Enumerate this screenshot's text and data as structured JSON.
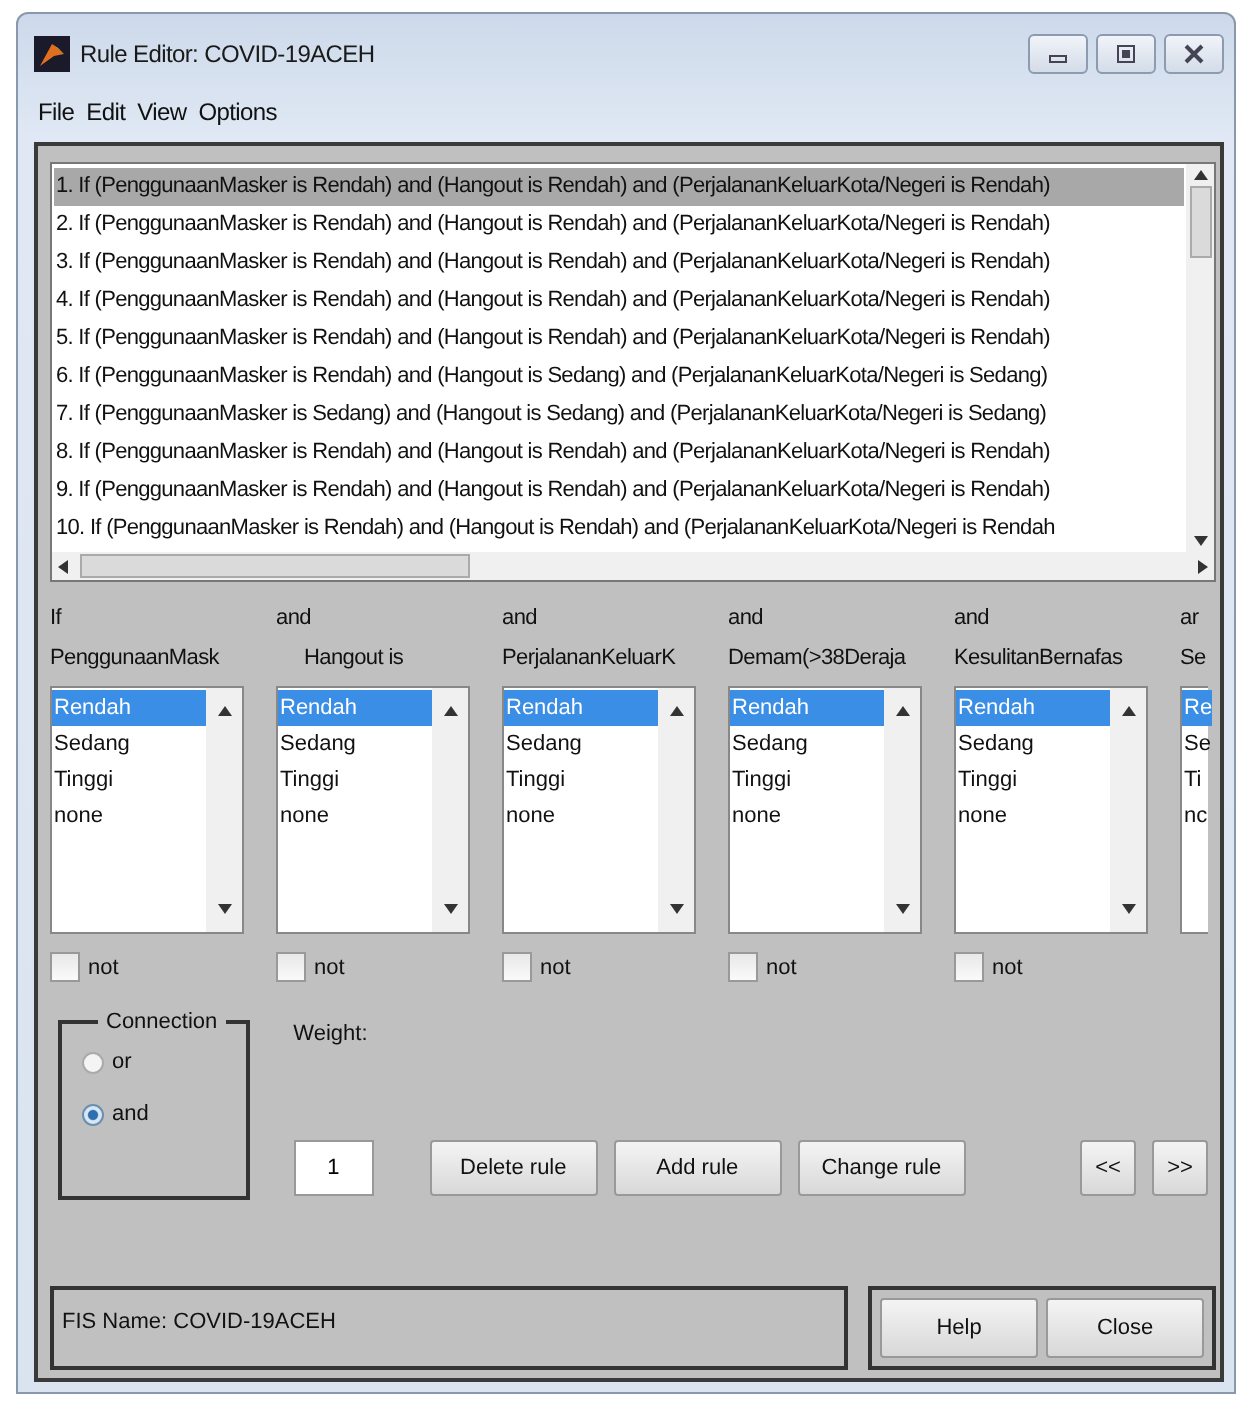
{
  "window": {
    "title": "Rule Editor: COVID-19ACEH"
  },
  "menu": [
    "File",
    "Edit",
    "View",
    "Options"
  ],
  "rules": [
    {
      "text": "1. If (PenggunaanMasker is Rendah) and (Hangout is Rendah) and (PerjalananKeluarKota/Negeri is Rendah)",
      "selected": true
    },
    {
      "text": "2. If (PenggunaanMasker is Rendah) and (Hangout is Rendah) and (PerjalananKeluarKota/Negeri is Rendah)",
      "selected": false
    },
    {
      "text": "3. If (PenggunaanMasker is Rendah) and (Hangout is Rendah) and (PerjalananKeluarKota/Negeri is Rendah)",
      "selected": false
    },
    {
      "text": "4. If (PenggunaanMasker is Rendah) and (Hangout is Rendah) and (PerjalananKeluarKota/Negeri is Rendah)",
      "selected": false
    },
    {
      "text": "5. If (PenggunaanMasker is Rendah) and (Hangout is Rendah) and (PerjalananKeluarKota/Negeri is Rendah)",
      "selected": false
    },
    {
      "text": "6. If (PenggunaanMasker is Rendah) and (Hangout is Sedang) and (PerjalananKeluarKota/Negeri is Sedang)",
      "selected": false
    },
    {
      "text": "7. If (PenggunaanMasker is Sedang) and (Hangout is Sedang) and (PerjalananKeluarKota/Negeri is Sedang)",
      "selected": false
    },
    {
      "text": "8. If (PenggunaanMasker is Rendah) and (Hangout is Rendah) and (PerjalananKeluarKota/Negeri is Rendah)",
      "selected": false
    },
    {
      "text": "9. If (PenggunaanMasker is Rendah) and (Hangout is Rendah) and (PerjalananKeluarKota/Negeri is Rendah)",
      "selected": false
    },
    {
      "text": "10. If (PenggunaanMasker is Rendah) and (Hangout is Rendah) and (PerjalananKeluarKota/Negeri is Rendah",
      "selected": false
    }
  ],
  "columns": [
    {
      "connector": "If",
      "label": "PenggunaanMask",
      "items": [
        {
          "text": "Rendah",
          "selected": true
        },
        {
          "text": "Sedang",
          "selected": false
        },
        {
          "text": "Tinggi",
          "selected": false
        },
        {
          "text": "none",
          "selected": false
        }
      ],
      "not_label": "not",
      "not_checked": false
    },
    {
      "connector": "and",
      "label": "Hangout is",
      "items": [
        {
          "text": "Rendah",
          "selected": true
        },
        {
          "text": "Sedang",
          "selected": false
        },
        {
          "text": "Tinggi",
          "selected": false
        },
        {
          "text": "none",
          "selected": false
        }
      ],
      "not_label": "not",
      "not_checked": false
    },
    {
      "connector": "and",
      "label": "PerjalananKeluarK",
      "items": [
        {
          "text": "Rendah",
          "selected": true
        },
        {
          "text": "Sedang",
          "selected": false
        },
        {
          "text": "Tinggi",
          "selected": false
        },
        {
          "text": "none",
          "selected": false
        }
      ],
      "not_label": "not",
      "not_checked": false
    },
    {
      "connector": "and",
      "label": "Demam(>38Deraja",
      "items": [
        {
          "text": "Rendah",
          "selected": true
        },
        {
          "text": "Sedang",
          "selected": false
        },
        {
          "text": "Tinggi",
          "selected": false
        },
        {
          "text": "none",
          "selected": false
        }
      ],
      "not_label": "not",
      "not_checked": false
    },
    {
      "connector": "and",
      "label": "KesulitanBernafas",
      "items": [
        {
          "text": "Rendah",
          "selected": true
        },
        {
          "text": "Sedang",
          "selected": false
        },
        {
          "text": "Tinggi",
          "selected": false
        },
        {
          "text": "none",
          "selected": false
        }
      ],
      "not_label": "not",
      "not_checked": false
    }
  ],
  "partial_column": {
    "connector": "ar",
    "label": "Se",
    "items": [
      {
        "text": "Re",
        "selected": true
      },
      {
        "text": "Se",
        "selected": false
      },
      {
        "text": "Ti",
        "selected": false
      },
      {
        "text": "nc",
        "selected": false
      }
    ]
  },
  "connection": {
    "title": "Connection",
    "options": [
      {
        "label": "or",
        "selected": false
      },
      {
        "label": "and",
        "selected": true
      }
    ]
  },
  "weight": {
    "label": "Weight:",
    "value": "1"
  },
  "actions": [
    "Delete rule",
    "Add rule",
    "Change rule"
  ],
  "nav": [
    "<<",
    ">>"
  ],
  "status": "FIS Name: COVID-19ACEH",
  "footer_buttons": [
    "Help",
    "Close"
  ]
}
